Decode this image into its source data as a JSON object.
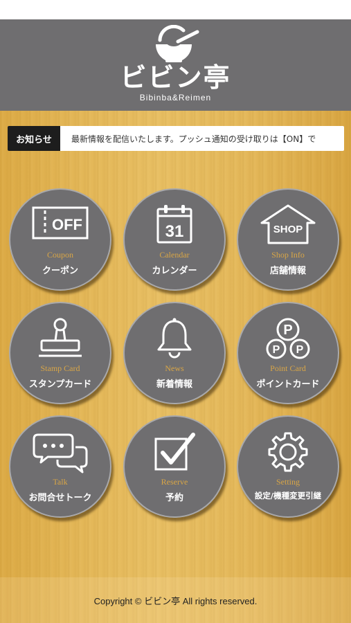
{
  "header": {
    "logo_text": "ビビン亭",
    "logo_sub": "Bibinba&Reimen"
  },
  "news": {
    "label": "お知らせ",
    "text": "最新情報を配信いたします。プッシュ通知の受け取りは【ON】で"
  },
  "menu": [
    {
      "en": "Coupon",
      "jp": "クーポン",
      "icon": "coupon-off-icon",
      "icon_text": "OFF"
    },
    {
      "en": "Calendar",
      "jp": "カレンダー",
      "icon": "calendar-icon",
      "icon_text": "31"
    },
    {
      "en": "Shop Info",
      "jp": "店舗情報",
      "icon": "shop-icon",
      "icon_text": "SHOP"
    },
    {
      "en": "Stamp Card",
      "jp": "スタンプカード",
      "icon": "stamp-icon"
    },
    {
      "en": "News",
      "jp": "新着情報",
      "icon": "bell-icon"
    },
    {
      "en": "Point Card",
      "jp": "ポイントカード",
      "icon": "point-coins-icon",
      "icon_text": "P"
    },
    {
      "en": "Talk",
      "jp": "お問合せトーク",
      "icon": "chat-bubbles-icon"
    },
    {
      "en": "Reserve",
      "jp": "予約",
      "icon": "checkbox-icon"
    },
    {
      "en": "Setting",
      "jp": "設定/機種変更引継",
      "icon": "gear-icon"
    }
  ],
  "footer": {
    "copyright": "Copyright © ビビン亭 All rights reserved."
  },
  "colors": {
    "header_bg": "#6f6e70",
    "tile_bg": "#6f6e70",
    "tile_en_text": "#d9a646",
    "wood_light": "#e8bf63"
  }
}
